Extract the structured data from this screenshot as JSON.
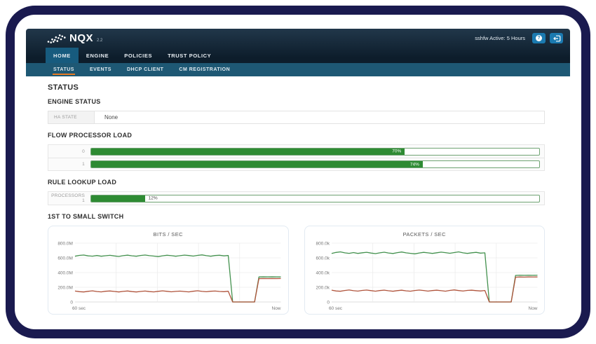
{
  "frame": {
    "color": "#1a1a4f"
  },
  "header": {
    "logo_text": "NQX",
    "logo_version": "2.2",
    "session_text": "sshfw Active: 5 Hours",
    "help_glyph": "?",
    "button_color": "#1b7ab0"
  },
  "nav": {
    "items": [
      {
        "label": "HOME",
        "active": true
      },
      {
        "label": "ENGINE",
        "active": false
      },
      {
        "label": "POLICIES",
        "active": false
      },
      {
        "label": "TRUST POLICY",
        "active": false
      }
    ]
  },
  "subnav": {
    "active_underline_color": "#e87a22",
    "items": [
      {
        "label": "STATUS",
        "active": true
      },
      {
        "label": "EVENTS",
        "active": false
      },
      {
        "label": "DHCP CLIENT",
        "active": false
      },
      {
        "label": "CM REGISTRATION",
        "active": false
      }
    ]
  },
  "page": {
    "title": "STATUS",
    "engine_status": {
      "heading": "ENGINE STATUS",
      "rows": [
        {
          "label": "HA STATE",
          "value": "None"
        }
      ]
    },
    "flow_processor_load": {
      "heading": "FLOW PROCESSOR LOAD",
      "bar_color": "#2e8b33",
      "rows": [
        {
          "label": "0",
          "percent": 70
        },
        {
          "label": "1",
          "percent": 74
        }
      ]
    },
    "rule_lookup_load": {
      "heading": "RULE LOOKUP LOAD",
      "rows": [
        {
          "label": "PROCESSORS 1",
          "percent": 12
        }
      ]
    },
    "switch_section_heading": "1ST TO SMALL SWITCH"
  },
  "chart_data": [
    {
      "type": "line",
      "title": "BITS / SEC",
      "x_start_label": "60 sec",
      "x_end_label": "Now",
      "ylim": [
        0,
        800
      ],
      "yticks": {
        "values": [
          0,
          200,
          400,
          600,
          800
        ],
        "labels": [
          "0",
          "200.0M",
          "400.0M",
          "600.0M",
          "800.0M"
        ]
      },
      "grid": true,
      "legend": "none",
      "series": [
        {
          "name": "green",
          "color": "#43914e",
          "values": [
            622,
            633,
            638,
            627,
            623,
            631,
            622,
            629,
            634,
            626,
            619,
            630,
            636,
            628,
            622,
            632,
            638,
            630,
            624,
            617,
            628,
            635,
            630,
            622,
            630,
            637,
            631,
            624,
            633,
            640,
            630,
            622,
            631,
            635,
            627,
            631,
            0,
            0,
            0,
            0,
            0,
            0,
            340,
            341,
            340,
            341,
            340,
            340
          ]
        },
        {
          "name": "red",
          "color": "#b0543c",
          "values": [
            149,
            140,
            136,
            145,
            151,
            142,
            137,
            146,
            150,
            143,
            136,
            144,
            150,
            141,
            136,
            143,
            149,
            141,
            137,
            145,
            151,
            145,
            138,
            144,
            148,
            142,
            137,
            146,
            152,
            144,
            139,
            146,
            149,
            143,
            140,
            146,
            0,
            0,
            0,
            0,
            0,
            0,
            317,
            319,
            318,
            319,
            318,
            319
          ]
        }
      ]
    },
    {
      "type": "line",
      "title": "PACKETS / SEC",
      "x_start_label": "60 sec",
      "x_end_label": "Now",
      "ylim": [
        0,
        800
      ],
      "yticks": {
        "values": [
          0,
          200,
          400,
          600,
          800
        ],
        "labels": [
          "0",
          "200.0k",
          "400.0k",
          "600.0k",
          "800.0k"
        ]
      },
      "grid": true,
      "legend": "none",
      "series": [
        {
          "name": "green",
          "color": "#43914e",
          "values": [
            660,
            673,
            681,
            668,
            661,
            671,
            660,
            669,
            675,
            665,
            657,
            668,
            676,
            666,
            659,
            670,
            679,
            668,
            661,
            654,
            666,
            674,
            668,
            660,
            669,
            677,
            670,
            662,
            671,
            681,
            668,
            660,
            669,
            674,
            664,
            668,
            0,
            0,
            0,
            0,
            0,
            0,
            361,
            363,
            362,
            363,
            362,
            363
          ]
        },
        {
          "name": "red",
          "color": "#b0543c",
          "values": [
            161,
            150,
            146,
            156,
            163,
            153,
            148,
            157,
            162,
            154,
            147,
            155,
            161,
            152,
            146,
            154,
            160,
            151,
            147,
            156,
            162,
            156,
            148,
            155,
            160,
            153,
            147,
            157,
            164,
            155,
            149,
            157,
            160,
            154,
            150,
            156,
            0,
            0,
            0,
            0,
            0,
            0,
            337,
            340,
            338,
            340,
            339,
            340
          ]
        }
      ]
    }
  ]
}
